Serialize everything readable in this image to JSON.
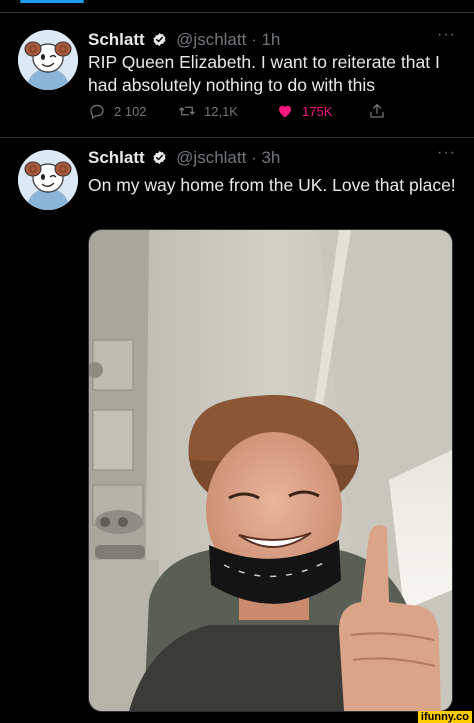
{
  "tweets": [
    {
      "name": "Schlatt",
      "handle": "@jschlatt",
      "separator": "·",
      "time": "1h",
      "text": "RIP Queen Elizabeth. I want to reiterate that I had absolutely nothing to do with this",
      "replies": "2 102",
      "retweets": "12,1K",
      "likes": "175K",
      "liked": true
    },
    {
      "name": "Schlatt",
      "handle": "@jschlatt",
      "separator": "·",
      "time": "3h",
      "text": "On my way home from the UK. Love that place!"
    }
  ],
  "more_glyph": "···",
  "watermark": "ifunny.co",
  "colors": {
    "background": "#000000",
    "text": "#e7e9ea",
    "muted": "#71767b",
    "verified": "#1d9bf0",
    "like": "#f91880",
    "divider": "#2f3336"
  },
  "icons": [
    "verified-badge-icon",
    "reply-icon",
    "retweet-icon",
    "heart-icon",
    "share-icon",
    "more-icon"
  ]
}
